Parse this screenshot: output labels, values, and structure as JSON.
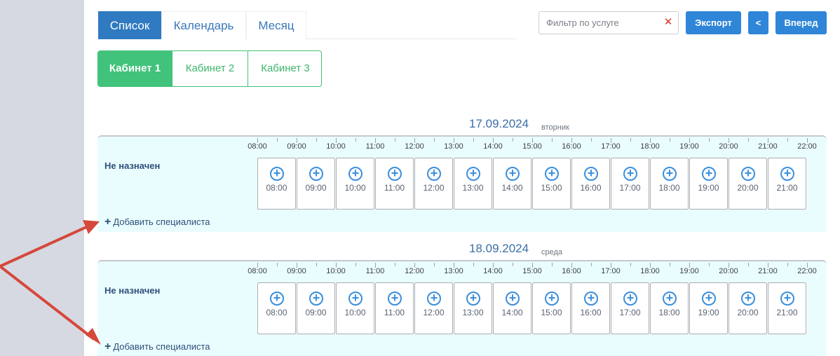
{
  "view_tabs": [
    {
      "label": "Список",
      "active": true
    },
    {
      "label": "Календарь",
      "active": false
    },
    {
      "label": "Месяц",
      "active": false
    }
  ],
  "filter": {
    "placeholder": "Фильтр по услуге",
    "value": "",
    "clear_icon": "close-icon"
  },
  "buttons": {
    "export": "Экспорт",
    "prev": "<",
    "next": "Вперед"
  },
  "cabinets": [
    {
      "label": "Кабинет 1",
      "active": true
    },
    {
      "label": "Кабинет 2",
      "active": false
    },
    {
      "label": "Кабинет 3",
      "active": false
    }
  ],
  "colors": {
    "accent_blue": "#2f7ac0",
    "accent_green": "#41c37b",
    "arrow_red": "#d5483b",
    "panel_bg": "#eafdfe"
  },
  "ruler_hours": [
    "08:00",
    "09:00",
    "10:00",
    "11:00",
    "12:00",
    "13:00",
    "14:00",
    "15:00",
    "16:00",
    "17:00",
    "18:00",
    "19:00",
    "20:00",
    "21:00",
    "22:00"
  ],
  "days": [
    {
      "date": "17.09.2024",
      "weekday": "вторник",
      "specialist": "Не назначен",
      "slots": [
        "08:00",
        "09:00",
        "10:00",
        "11:00",
        "12:00",
        "13:00",
        "14:00",
        "15:00",
        "16:00",
        "17:00",
        "18:00",
        "19:00",
        "20:00",
        "21:00"
      ],
      "add_label": "Добавить специалиста"
    },
    {
      "date": "18.09.2024",
      "weekday": "среда",
      "specialist": "Не назначен",
      "slots": [
        "08:00",
        "09:00",
        "10:00",
        "11:00",
        "12:00",
        "13:00",
        "14:00",
        "15:00",
        "16:00",
        "17:00",
        "18:00",
        "19:00",
        "20:00",
        "21:00"
      ],
      "add_label": "Добавить специалиста"
    }
  ]
}
